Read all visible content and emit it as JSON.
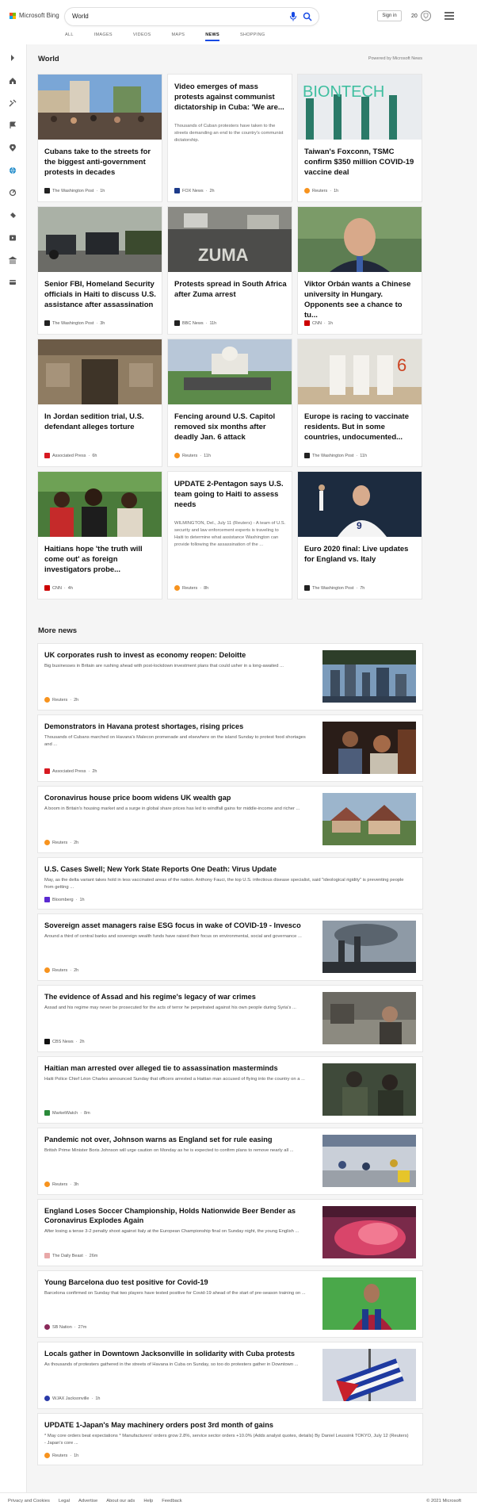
{
  "header": {
    "logo_text": "Microsoft Bing",
    "search_value": "World",
    "tabs": [
      {
        "label": "ALL"
      },
      {
        "label": "IMAGES"
      },
      {
        "label": "VIDEOS"
      },
      {
        "label": "MAPS"
      },
      {
        "label": "NEWS"
      },
      {
        "label": "SHOPPING"
      }
    ],
    "active_tab": "NEWS",
    "sign_in_label": "Sign in",
    "rewards_count": "20",
    "accent_color": "#174ae4"
  },
  "sidebar": {
    "icons": [
      "chevron-right-icon",
      "home-icon",
      "tools-icon",
      "flag-icon",
      "map-pin-icon",
      "globe-icon",
      "business-icon",
      "science-icon",
      "entertainment-icon",
      "bank-icon",
      "payment-icon"
    ]
  },
  "main": {
    "section_title": "World",
    "powered_by": "Powered by Microsoft News",
    "cards": [
      {
        "title": "Cubans take to the streets for the biggest anti-government protests in decades",
        "source": "The Washington Post",
        "time": "1h",
        "image": "crowd-protest-photo",
        "snippet": ""
      },
      {
        "title": "Video emerges of mass protests against communist dictatorship in Cuba: 'We are...",
        "source": "FOX News",
        "time": "2h",
        "image": "",
        "snippet": "Thousands of Cuban protesters have taken to the streets demanding an end to the country's communist dictatorship."
      },
      {
        "title": "Taiwan's Foxconn, TSMC confirm $350 million COVID-19 vaccine deal",
        "source": "Reuters",
        "time": "1h",
        "image": "biontech-vials-photo",
        "snippet": ""
      },
      {
        "title": "Senior FBI, Homeland Security officials in Haiti to discuss U.S. assistance after assassination",
        "source": "The Washington Post",
        "time": "3h",
        "image": "motorcade-photo",
        "snippet": ""
      },
      {
        "title": "Protests spread in South Africa after Zuma arrest",
        "source": "BBC News",
        "time": "11h",
        "image": "zuma-graffiti-photo",
        "snippet": ""
      },
      {
        "title": "Viktor Orbán wants a Chinese university in Hungary. Opponents see a chance to tu...",
        "source": "CNN",
        "time": "1h",
        "image": "orban-portrait-photo",
        "snippet": ""
      },
      {
        "title": "In Jordan sedition trial, U.S. defendant alleges torture",
        "source": "Associated Press",
        "time": "6h",
        "image": "jordan-gate-photo",
        "snippet": ""
      },
      {
        "title": "Fencing around U.S. Capitol removed six months after deadly Jan. 6 attack",
        "source": "Reuters",
        "time": "11h",
        "image": "capitol-fence-photo",
        "snippet": ""
      },
      {
        "title": "Europe is racing to vaccinate residents. But in some countries, undocumented...",
        "source": "The Washington Post",
        "time": "11h",
        "image": "vaccine-booths-photo",
        "snippet": ""
      },
      {
        "title": "Haitians hope 'the truth will come out' as foreign investigators probe...",
        "source": "CNN",
        "time": "4h",
        "image": "haiti-crowd-photo",
        "snippet": ""
      },
      {
        "title": "UPDATE 2-Pentagon says U.S. team going to Haiti to assess needs",
        "source": "Reuters",
        "time": "8h",
        "image": "",
        "snippet": "WILMINGTON, Del., July 11 (Reuters) - A team of U.S. security and law enforcement experts is traveling to Haiti to determine what assistance Washington can provide following the assassination of the ..."
      },
      {
        "title": "Euro 2020 final: Live updates for England vs. Italy",
        "source": "The Washington Post",
        "time": "7h",
        "image": "kane-celebration-photo",
        "snippet": ""
      }
    ],
    "more_news_title": "More news",
    "more_news": [
      {
        "title": "UK corporates rush to invest as economy reopen: Deloitte",
        "snippet": "Big businesses in Britain are rushing ahead with post-lockdown investment plans that could usher in a long-awaited ...",
        "source": "Reuters",
        "time": "2h",
        "image": "london-skyline-photo"
      },
      {
        "title": "Demonstrators in Havana protest shortages, rising prices",
        "snippet": "Thousands of Cubans marched on Havana's Malecon promenade and elsewhere on the island Sunday to protest food shortages and ...",
        "source": "Associated Press",
        "time": "2h",
        "image": "havana-arrest-photo"
      },
      {
        "title": "Coronavirus house price boom widens UK wealth gap",
        "snippet": "A boom in Britain's housing market and a surge in global share prices has led to windfall gains for middle-income and richer ...",
        "source": "Reuters",
        "time": "2h",
        "image": "uk-houses-photo"
      },
      {
        "title": "U.S. Cases Swell; New York State Reports One Death: Virus Update",
        "snippet": "May, as the delta variant takes hold in less vaccinated areas of the nation. Anthony Fauci, the top U.S. infectious disease specialist, said \"ideological rigidity\" is preventing people from getting ...",
        "source": "Bloomberg",
        "time": "1h",
        "image": ""
      },
      {
        "title": "Sovereign asset managers raise ESG focus in wake of COVID-19 - Invesco",
        "snippet": "Around a third of central banks and sovereign wealth funds have raised their focus on environmental, social and governance ...",
        "source": "Reuters",
        "time": "2h",
        "image": "smokestack-photo"
      },
      {
        "title": "The evidence of Assad and his regime's legacy of war crimes",
        "snippet": "Assad and his regime may never be prosecuted for the acts of terror he perpetrated against his own people during Syria's ...",
        "source": "CBS News",
        "time": "2h",
        "image": "syria-flood-photo"
      },
      {
        "title": "Haitian man arrested over alleged tie to assassination masterminds",
        "snippet": "Haiti Police Chief Léon Charles announced Sunday that officers arrested a Haitian man accused of flying into the country on a ...",
        "source": "MarketWatch",
        "time": "8m",
        "image": "haiti-police-photo"
      },
      {
        "title": "Pandemic not over, Johnson warns as England set for rule easing",
        "snippet": "British Prime Minister Boris Johnson will urge caution on Monday as he is expected to confirm plans to remove nearly all ...",
        "source": "Reuters",
        "time": "3h",
        "image": "vaccination-hall-photo"
      },
      {
        "title": "England Loses Soccer Championship, Holds Nationwide Beer Bender as Coronavirus Explodes Again",
        "snippet": "After losing a tense 3-2 penalty shoot against Italy at the European Championship final on Sunday night, the young English ...",
        "source": "The Daily Beast",
        "time": "26m",
        "image": "fans-flare-photo"
      },
      {
        "title": "Young Barcelona duo test positive for Covid-19",
        "snippet": "Barcelona confirmed on Sunday that two players have tested positive for Covid-19 ahead of the start of pre-season training on ...",
        "source": "SB Nation",
        "time": "27m",
        "image": "barcelona-player-photo"
      },
      {
        "title": "Locals gather in Downtown Jacksonville in solidarity with Cuba protests",
        "snippet": "As thousands of protesters gathered in the streets of Havana in Cuba on Sunday, so too do protesters gather in Downtown ...",
        "source": "WJAX Jacksonville",
        "time": "1h",
        "image": "cuba-flag-photo"
      },
      {
        "title": "UPDATE 1-Japan's May machinery orders post 3rd month of gains",
        "snippet": "* May core orders beat expectations * Manufacturers' orders grow 2.8%, service sector orders +10.0% (Adds analyst quotes, details) By Daniel Leussink TOKYO, July 12 (Reuters) - Japan's core ...",
        "source": "Reuters",
        "time": "1h",
        "image": ""
      }
    ]
  },
  "footer": {
    "links": [
      "Privacy and Cookies",
      "Legal",
      "Advertise",
      "About our ads",
      "Help",
      "Feedback"
    ],
    "copyright": "© 2021 Microsoft"
  }
}
